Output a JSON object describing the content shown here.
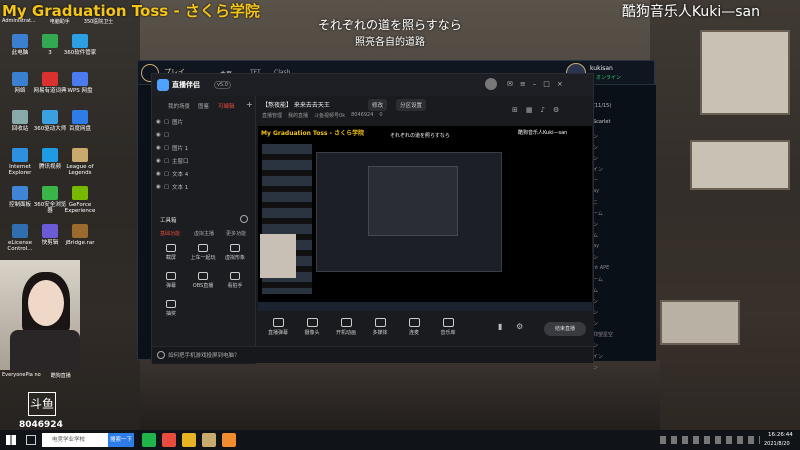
{
  "overlay": {
    "title_left": "My Graduation Toss - さくら学院",
    "title_right": "酷狗音乐人Kuki—san",
    "lyric_jp": "それぞれの道を照らすなら",
    "lyric_cn": "照亮各自的道路",
    "desktop_top_labels": [
      "Administrat...",
      "电脑助手",
      "350医院卫士"
    ]
  },
  "desktop_icons": [
    {
      "label": "此电脑",
      "color": "#3b7fd1"
    },
    {
      "label": "3",
      "color": "#33a852"
    },
    {
      "label": "360软件管家",
      "color": "#2c9fe2"
    },
    {
      "label": "网络",
      "color": "#3b7fd1"
    },
    {
      "label": "网易有道词典",
      "color": "#d93030"
    },
    {
      "label": "WPS 网盘",
      "color": "#4a7cf0"
    },
    {
      "label": "回收站",
      "color": "#8aa"
    },
    {
      "label": "360驱动大师",
      "color": "#3aa0e0"
    },
    {
      "label": "百度网盘",
      "color": "#2f7be8"
    },
    {
      "label": "Internet Explorer",
      "color": "#2d8fe0"
    },
    {
      "label": "腾讯视频",
      "color": "#1f9be6"
    },
    {
      "label": "League of Legends",
      "color": "#c8aa6e"
    },
    {
      "label": "控制面板",
      "color": "#3f84d6"
    },
    {
      "label": "360安全浏览器",
      "color": "#39b54a"
    },
    {
      "label": "GeForce Experience",
      "color": "#76b900"
    },
    {
      "label": "eLicense Control...",
      "color": "#2f6fb0"
    },
    {
      "label": "快剪辑",
      "color": "#6b5bd6"
    },
    {
      "label": "jBridge.rar",
      "color": "#9b6a2f"
    },
    {
      "label": "腾讯QQ",
      "color": "#1e9be9"
    },
    {
      "label": "腾讯会议",
      "color": "#2a7cf6"
    }
  ],
  "webcam": {
    "bottom_labels": [
      "EveryonePia no",
      "酷狗直播"
    ],
    "logo_text": "斗鱼",
    "room_number": "8046924"
  },
  "lol_client": {
    "tabs": [
      "主页",
      "TFT",
      "Clash"
    ],
    "play_label": "プレイ",
    "username": "kukisan",
    "user_status": "● オンライン",
    "friends_header": "(11/15)",
    "friend_sample": "Scarlet",
    "friend_status": [
      "ン",
      "ン",
      "ン",
      "イン",
      "ー",
      "ay",
      "ニ",
      "ーム",
      "ン",
      "ム",
      "ay",
      "ン",
      "nt APE",
      "ーム",
      "ム",
      "ン",
      "ン",
      "ン",
      "仰望星空",
      "ン",
      "イン",
      "ン"
    ],
    "footer": "ン"
  },
  "streaming_app": {
    "brand": "直播伴侣",
    "version": "v5.0",
    "side_tabs": [
      "我的场景",
      "图鉴",
      "可编辑"
    ],
    "layers": [
      "图片",
      "",
      "图片 1",
      "主窗口",
      "文本 4",
      "文本 1"
    ],
    "tools_header": "工具箱",
    "tools_tabs": [
      "基础功能",
      "虚拟主播",
      "更多功能"
    ],
    "tools": [
      "截屏",
      "上车一起玩",
      "虚拟形象",
      "弹幕",
      "OBS直播",
      "看拍手",
      "抽奖"
    ],
    "stream_title": "【熬夜能】 来来去去天王",
    "tag1": "修改",
    "tag2": "分区设置",
    "meta": [
      "直播管理",
      "我的直播",
      "斗鱼视频号0k",
      "8046924",
      "0"
    ],
    "preview_title": "My Graduation Toss - さくら学院",
    "preview_right": "酷狗音乐人Kuki—san",
    "preview_lyric": "それぞれの道を照らすなら",
    "bottom_buttons": [
      "直播弹幕",
      "摄像头",
      "开机动画",
      "多媒体",
      "连麦",
      "音乐库"
    ],
    "start_button": "结束直播",
    "footer_text": "如何把手机游戏投屏到电脑？",
    "accent": "#e44a36"
  },
  "taskbar": {
    "search_placeholder": "电竞学业学校",
    "search_button": "搜索一下",
    "time": "16:26:44",
    "date": "2021/8/20"
  }
}
